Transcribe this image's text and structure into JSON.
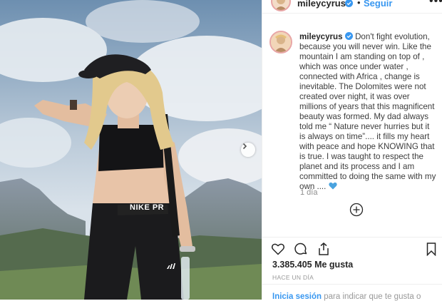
{
  "post": {
    "username": "mileycyrus",
    "follow_label": "Seguir",
    "separator": "•",
    "more_label": "•••"
  },
  "caption": {
    "username": "mileycyrus",
    "text": "Don't fight evolution, because you will never win. Like the mountain I am standing on top of , which was once under water , connected with Africa , change is inevitable. The Dolomites were not created over night, it was over millions of years that this magnificent beauty was formed. My dad always told me “ Nature never hurries but it is always on time”.... it fills my heart with peace and hope KNOWING that is true. I was taught to respect the planet and its process and I am committed to doing the same with my own ....",
    "emoji": "blue-heart",
    "time": "1 día"
  },
  "photo": {
    "shorts_text": "NIKE PR",
    "pants_logo": "adidas-logo"
  },
  "likes": "3.385.405 Me gusta",
  "date": "HACE UN DÍA",
  "footer": {
    "login_link": "Inicia sesión",
    "login_rest": "para indicar que te gusta o"
  },
  "icons": {
    "like": "heart-icon",
    "comment": "comment-icon",
    "share": "share-icon",
    "save": "bookmark-icon",
    "load_more": "add-circle-icon",
    "next": "chevron-right-icon"
  },
  "colors": {
    "link_blue": "#3897f0",
    "verified_blue": "#3897f0",
    "heart_blue": "#4aa3df",
    "text": "#262626",
    "muted": "#8e8e8e"
  }
}
